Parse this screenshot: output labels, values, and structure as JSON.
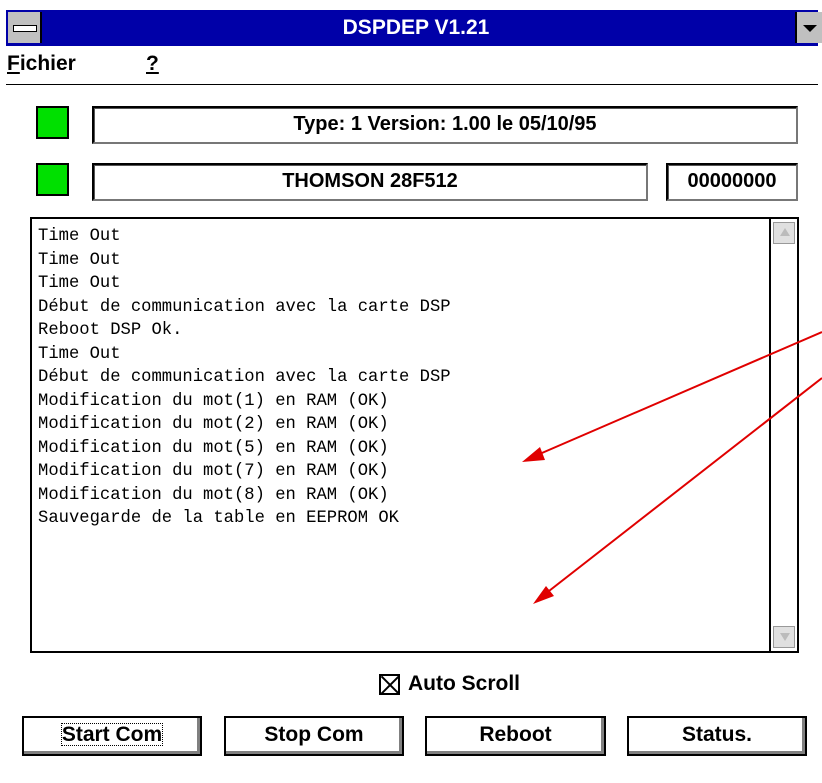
{
  "window": {
    "title": "DSPDEP V1.21"
  },
  "menu": {
    "items": [
      {
        "mnemonic": "F",
        "rest": "ichier"
      },
      {
        "mnemonic": "?",
        "rest": ""
      }
    ]
  },
  "status": {
    "led_color": "#00e000",
    "type_version": "Type: 1 Version:  1.00 le 05/10/95",
    "chip": "THOMSON 28F512",
    "address": "00000000"
  },
  "log": {
    "lines": [
      "Time Out",
      "Time Out",
      "Time Out",
      "Début de communication avec la carte DSP",
      "Reboot DSP Ok.",
      "Time Out",
      "Début de communication avec la carte DSP",
      "Modification du mot(1) en RAM (OK)",
      "Modification du mot(2) en RAM (OK)",
      "Modification du mot(5) en RAM (OK)",
      "Modification du mot(7) en RAM (OK)",
      "Modification du mot(8) en RAM (OK)",
      "Sauvegarde de la table en EEPROM OK"
    ]
  },
  "options": {
    "auto_scroll_label": "Auto Scroll",
    "auto_scroll_checked": true
  },
  "buttons": {
    "start": "Start Com",
    "stop": "Stop Com",
    "reboot": "Reboot",
    "status": "Status."
  },
  "annotation_color": "#e00000"
}
